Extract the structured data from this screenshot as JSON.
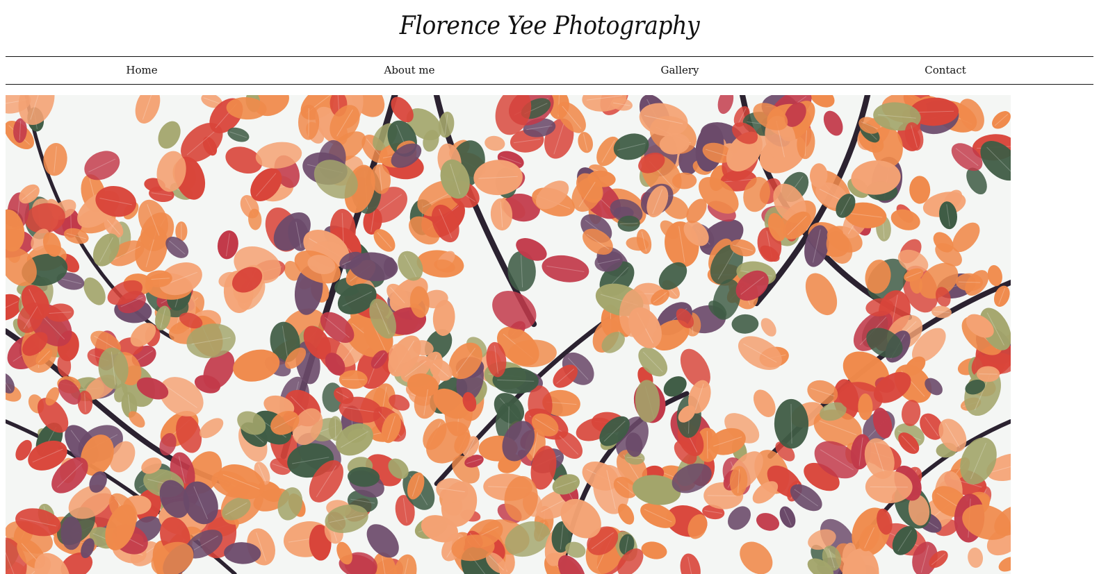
{
  "header": {
    "title": "Florence Yee Photography"
  },
  "nav": {
    "items": [
      {
        "label": "Home"
      },
      {
        "label": "About me"
      },
      {
        "label": "Gallery"
      },
      {
        "label": "Contact"
      }
    ]
  },
  "hero": {
    "subject": "autumn-leaves-photo",
    "colors": {
      "sky": "#f4f6f4",
      "branch": "#2b2230",
      "leaf_orange": "#f08a4b",
      "leaf_peach": "#f4a273",
      "leaf_red": "#d9453a",
      "leaf_crimson": "#c23a4a",
      "leaf_green": "#3f5c45",
      "leaf_olive": "#a3a56b",
      "leaf_purple": "#6b4a6a"
    }
  }
}
